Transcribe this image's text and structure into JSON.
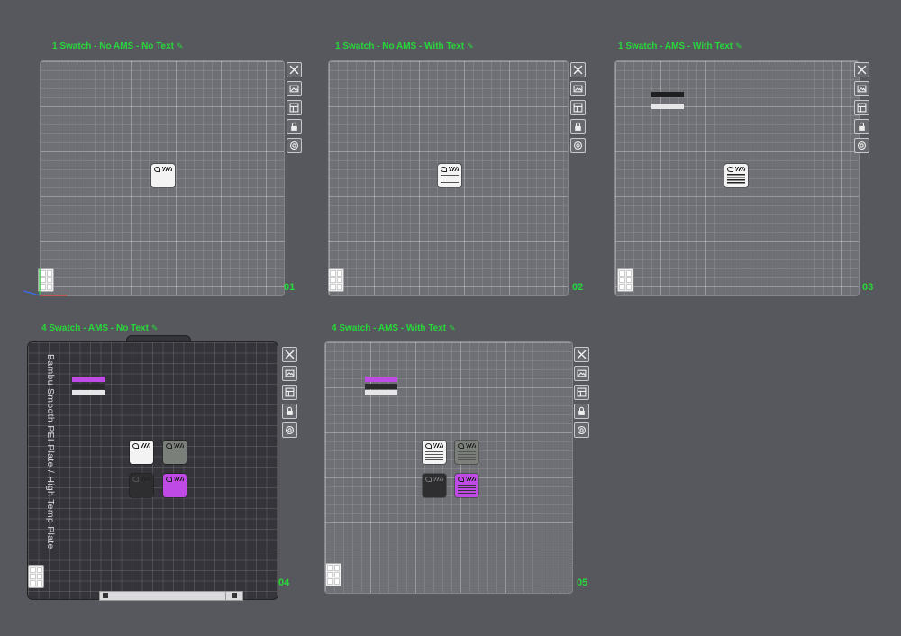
{
  "colors": {
    "background": "#57585d",
    "accent": "#27d83a",
    "plate_grey": "#6f7075",
    "plate_dark": "#34343a",
    "swatch_white": "#f3f3f3",
    "swatch_grey": "#7a7f7a",
    "swatch_black": "#2e2e30",
    "swatch_purple": "#c04ae6"
  },
  "toolbar_icons": [
    "close-icon",
    "image-icon",
    "layout-icon",
    "lock-icon",
    "settings-icon"
  ],
  "panels": [
    {
      "title": "1 Swatch - No AMS - No Text",
      "number": "01",
      "edit_icon": "✎"
    },
    {
      "title": "1 Swatch - No AMS - With Text",
      "number": "02",
      "edit_icon": "✎"
    },
    {
      "title": "1 Swatch - AMS - With Text",
      "number": "03",
      "edit_icon": "✎"
    },
    {
      "title": "4 Swatch - AMS - No Text",
      "number": "04",
      "edit_icon": "✎",
      "plate_label": "Bambu Smooth PEI Plate / High Temp Plate"
    },
    {
      "title": "4 Swatch - AMS - With Text",
      "number": "05",
      "edit_icon": "✎"
    }
  ]
}
